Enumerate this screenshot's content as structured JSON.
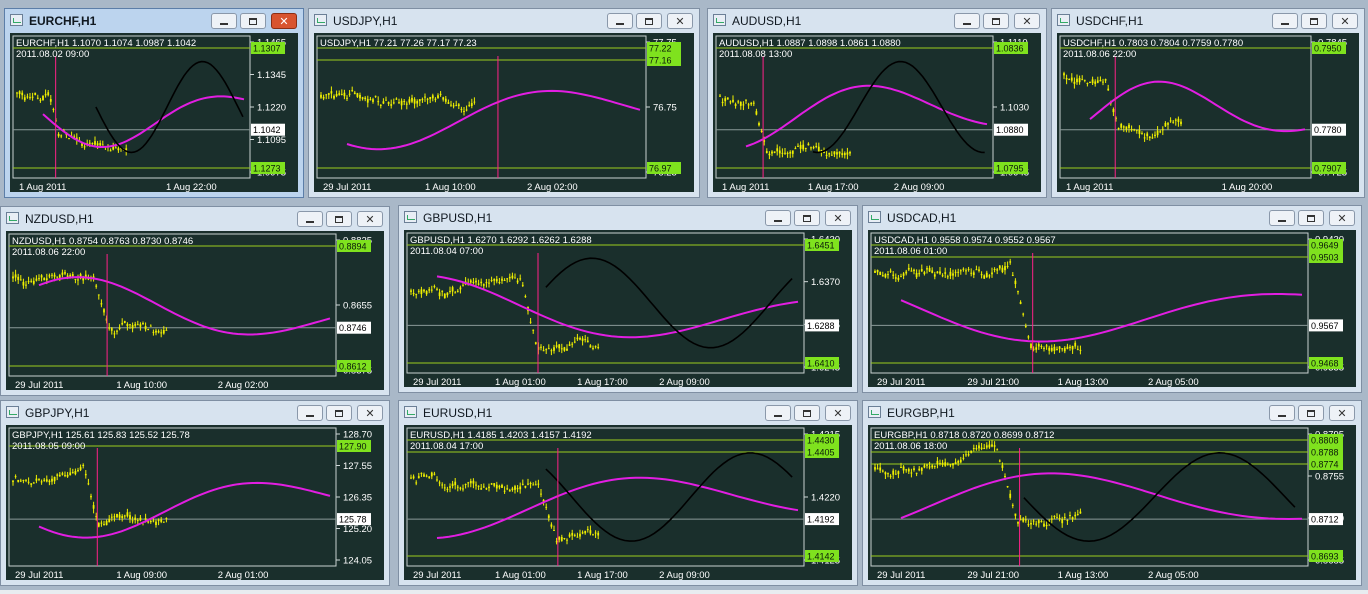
{
  "colors": {
    "desktop": "#a9b8c8",
    "chart_bg": "#1a2f2c",
    "candle": "#f0f000",
    "ma_black": "#000000",
    "ma_magenta": "#e21ee2",
    "level_line": "#9ccc1e",
    "level_box": "#7fe21e",
    "current_box": "#ffffff",
    "vline": "#ff2288",
    "grid": "#8a9a98"
  },
  "windows": [
    {
      "id": "eurchf",
      "title": "EURCHF,H1",
      "active": true,
      "header": "EURCHF,H1  1.1070 1.1074 1.0987 1.1042",
      "timestamp": "2011.08.02 09:00",
      "price_ticks": [
        "1.1465",
        "1.1345",
        "1.1220",
        "1.1095",
        "1.0975"
      ],
      "time_ticks": [
        "1 Aug 2011",
        "1 Aug 22:00"
      ],
      "green_levels": [
        "1.1307",
        "1.1273"
      ],
      "current": "1.1042",
      "icons": [
        "chart-icon",
        "minimize-icon",
        "maximize-icon",
        "close-icon"
      ]
    },
    {
      "id": "usdjpy",
      "title": "USDJPY,H1",
      "active": false,
      "header": "USDJPY,H1  77.21 77.26 77.17 77.23",
      "timestamp": "",
      "price_ticks": [
        "77.75",
        "76.75",
        "76.25"
      ],
      "time_ticks": [
        "29 Jul 2011",
        "1 Aug 10:00",
        "2 Aug 02:00"
      ],
      "green_levels": [
        "77.22",
        "77.16",
        "76.97"
      ],
      "current": "",
      "icons": [
        "chart-icon",
        "minimize-icon",
        "maximize-icon",
        "close-icon"
      ]
    },
    {
      "id": "audusd",
      "title": "AUDUSD,H1",
      "active": false,
      "header": "AUDUSD,H1  1.0887 1.0898 1.0861 1.0880",
      "timestamp": "2011.08.08 13:00",
      "price_ticks": [
        "1.1110",
        "1.1030",
        "1.0945"
      ],
      "time_ticks": [
        "1 Aug 2011",
        "1 Aug 17:00",
        "2 Aug 09:00"
      ],
      "green_levels": [
        "1.0836",
        "1.0795"
      ],
      "current": "1.0880",
      "icons": [
        "chart-icon",
        "minimize-icon",
        "maximize-icon",
        "close-icon"
      ]
    },
    {
      "id": "usdchf",
      "title": "USDCHF,H1",
      "active": false,
      "header": "USDCHF,H1  0.7803 0.7804 0.7759 0.7780",
      "timestamp": "2011.08.06 22:00",
      "price_ticks": [
        "0.7845",
        "0.7725"
      ],
      "time_ticks": [
        "1 Aug 2011",
        "1 Aug 20:00"
      ],
      "green_levels": [
        "0.7950",
        "0.7907"
      ],
      "current": "0.7780",
      "icons": [
        "chart-icon",
        "minimize-icon",
        "maximize-icon",
        "close-icon"
      ]
    },
    {
      "id": "nzdusd",
      "title": "NZDUSD,H1",
      "active": false,
      "header": "NZDUSD,H1  0.8754 0.8763 0.8730 0.8746",
      "timestamp": "2011.08.06 22:00",
      "price_ticks": [
        "0.8825",
        "0.8655",
        "0.8575"
      ],
      "time_ticks": [
        "29 Jul 2011",
        "1 Aug 10:00",
        "2 Aug 02:00"
      ],
      "green_levels": [
        "0.8894",
        "0.8612"
      ],
      "current": "0.8746",
      "icons": [
        "chart-icon",
        "minimize-icon",
        "maximize-icon",
        "close-icon"
      ]
    },
    {
      "id": "gbpusd",
      "title": "GBPUSD,H1",
      "active": false,
      "header": "GBPUSD,H1  1.6270 1.6292 1.6262 1.6288",
      "timestamp": "2011.08.04 07:00",
      "price_ticks": [
        "1.6430",
        "1.6370",
        "1.6305",
        "1.6245"
      ],
      "time_ticks": [
        "29 Jul 2011",
        "1 Aug 01:00",
        "1 Aug 17:00",
        "2 Aug 09:00"
      ],
      "green_levels": [
        "1.6451",
        "1.6410"
      ],
      "current": "1.6288",
      "icons": [
        "chart-icon",
        "minimize-icon",
        "maximize-icon",
        "close-icon"
      ]
    },
    {
      "id": "usdcad",
      "title": "USDCAD,H1",
      "active": false,
      "header": "USDCAD,H1  0.9558 0.9574 0.9552 0.9567",
      "timestamp": "2011.08.06 01:00",
      "price_ticks": [
        "0.9430",
        "0.9355"
      ],
      "time_ticks": [
        "29 Jul 2011",
        "29 Jul 21:00",
        "1 Aug 13:00",
        "2 Aug 05:00"
      ],
      "green_levels": [
        "0.9649",
        "0.9503",
        "0.9468"
      ],
      "current": "0.9567",
      "icons": [
        "chart-icon",
        "minimize-icon",
        "maximize-icon",
        "close-icon"
      ]
    },
    {
      "id": "gbpjpy",
      "title": "GBPJPY,H1",
      "active": false,
      "header": "GBPJPY,H1  125.61 125.83 125.52 125.78",
      "timestamp": "2011.08.05 09:00",
      "price_ticks": [
        "128.70",
        "127.55",
        "126.35",
        "125.20",
        "124.05"
      ],
      "time_ticks": [
        "29 Jul 2011",
        "1 Aug 09:00",
        "2 Aug 01:00"
      ],
      "green_levels": [
        "127.90"
      ],
      "current": "125.78",
      "icons": [
        "chart-icon",
        "minimize-icon",
        "maximize-icon",
        "close-icon"
      ]
    },
    {
      "id": "eurusd",
      "title": "EURUSD,H1",
      "active": false,
      "header": "EURUSD,H1  1.4185 1.4203 1.4157 1.4192",
      "timestamp": "2011.08.04 17:00",
      "price_ticks": [
        "1.4315",
        "1.4220",
        "1.4125"
      ],
      "time_ticks": [
        "29 Jul 2011",
        "1 Aug 01:00",
        "1 Aug 17:00",
        "2 Aug 09:00"
      ],
      "green_levels": [
        "1.4430",
        "1.4405",
        "1.4142"
      ],
      "current": "1.4192",
      "icons": [
        "chart-icon",
        "minimize-icon",
        "maximize-icon",
        "close-icon"
      ]
    },
    {
      "id": "eurgbp",
      "title": "EURGBP,H1",
      "active": false,
      "header": "EURGBP,H1  0.8718 0.8720 0.8699 0.8712",
      "timestamp": "2011.08.06 18:00",
      "price_ticks": [
        "0.8795",
        "0.8755",
        "0.8720",
        "0.8685"
      ],
      "time_ticks": [
        "29 Jul 2011",
        "29 Jul 21:00",
        "1 Aug 13:00",
        "2 Aug 05:00"
      ],
      "green_levels": [
        "0.8808",
        "0.8788",
        "0.8774",
        "0.8693"
      ],
      "current": "0.8712",
      "icons": [
        "chart-icon",
        "minimize-icon",
        "maximize-icon",
        "close-icon"
      ]
    }
  ]
}
